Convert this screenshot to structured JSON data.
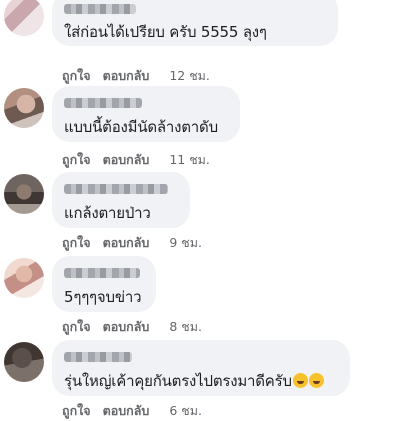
{
  "comments": [
    {
      "text": "ใส่ก่อนได้เปรียบ ครับ 5555 ลุงๆ",
      "like_label": "ถูกใจ",
      "reply_label": "ตอบกลับ",
      "time": "12 ชม.",
      "emoji_count": 0
    },
    {
      "text": "แบบนี้ต้องมีนัดล้างตาดับ",
      "like_label": "ถูกใจ",
      "reply_label": "ตอบกลับ",
      "time": "11 ชม.",
      "emoji_count": 0
    },
    {
      "text": "แกล้งตายป่าว",
      "like_label": "ถูกใจ",
      "reply_label": "ตอบกลับ",
      "time": "9 ชม.",
      "emoji_count": 0
    },
    {
      "text": "5ๆๆๆจบข่าว",
      "like_label": "ถูกใจ",
      "reply_label": "ตอบกลับ",
      "time": "8 ชม.",
      "emoji_count": 0
    },
    {
      "text": "รุ่นใหญ่เค้าคุยกันตรงไปตรงมาดีครับ",
      "like_label": "ถูกใจ",
      "reply_label": "ตอบกลับ",
      "time": "6 ชม.",
      "emoji_count": 2,
      "emoji_icon": "rofl-emoji-icon"
    }
  ]
}
